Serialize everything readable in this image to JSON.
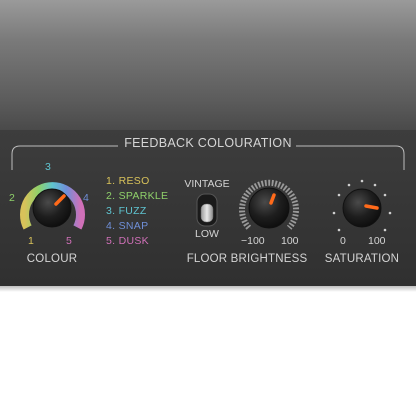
{
  "section_title": "FEEDBACK COLOURATION",
  "colour": {
    "label": "COLOUR",
    "scale": [
      "1",
      "2",
      "3",
      "4",
      "5"
    ],
    "modes": [
      {
        "text": "1. RESO",
        "color": "#d8c25a"
      },
      {
        "text": "2. SPARKLE",
        "color": "#8fd06a"
      },
      {
        "text": "3. FUZZ",
        "color": "#5fc4d0"
      },
      {
        "text": "4. SNAP",
        "color": "#6f8fd8"
      },
      {
        "text": "5. DUSK",
        "color": "#d070b8"
      }
    ]
  },
  "floor": {
    "label": "FLOOR",
    "top_option": "VINTAGE",
    "bottom_option": "LOW",
    "selected": "LOW"
  },
  "brightness": {
    "label": "BRIGHTNESS",
    "min": "−100",
    "max": "100"
  },
  "saturation": {
    "label": "SATURATION",
    "min": "0",
    "max": "100"
  },
  "colors": {
    "panel": "#363636",
    "label": "#d4d4d4",
    "indicator": "#ff6a1a"
  }
}
